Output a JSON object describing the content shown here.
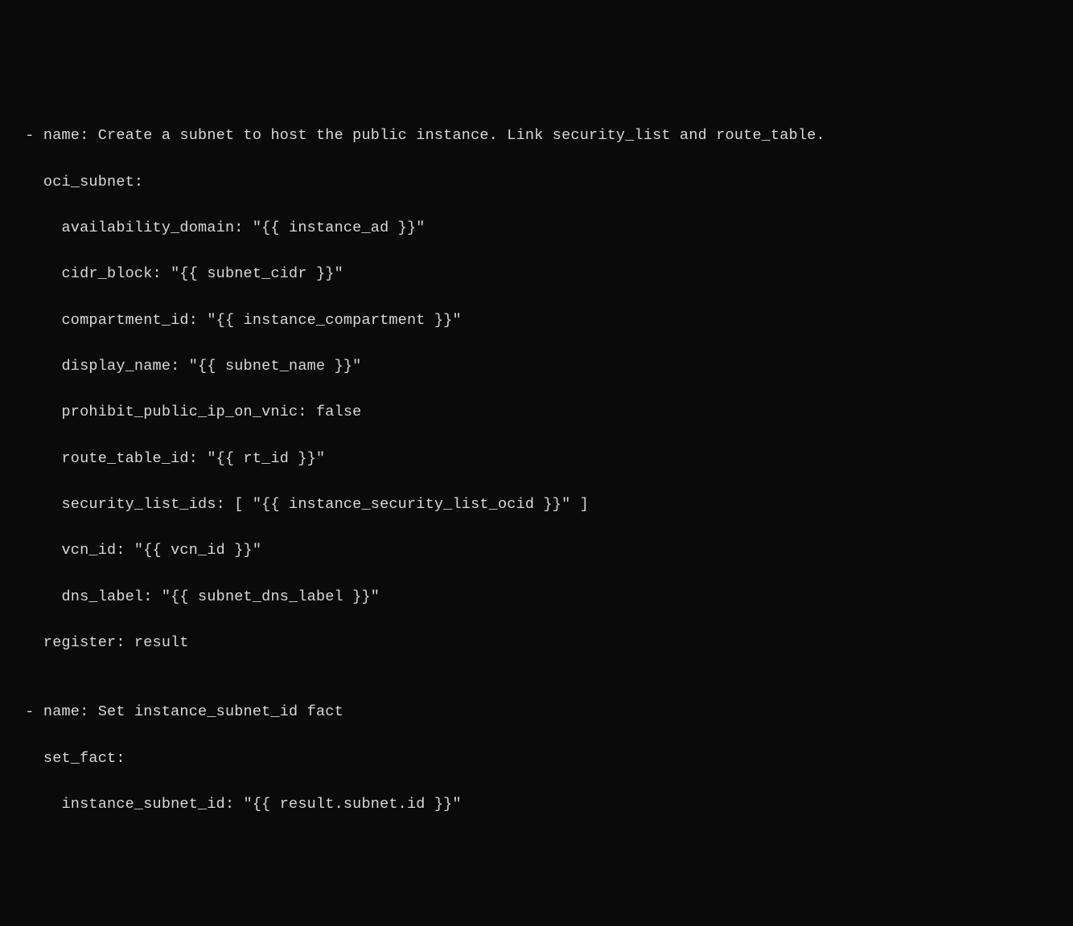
{
  "lines": [
    " - name: Create a subnet to host the public instance. Link security_list and route_table.",
    "   oci_subnet:",
    "     availability_domain: \"{{ instance_ad }}\"",
    "     cidr_block: \"{{ subnet_cidr }}\"",
    "     compartment_id: \"{{ instance_compartment }}\"",
    "     display_name: \"{{ subnet_name }}\"",
    "     prohibit_public_ip_on_vnic: false",
    "     route_table_id: \"{{ rt_id }}\"",
    "     security_list_ids: [ \"{{ instance_security_list_ocid }}\" ]",
    "     vcn_id: \"{{ vcn_id }}\"",
    "     dns_label: \"{{ subnet_dns_label }}\"",
    "   register: result",
    "",
    " - name: Set instance_subnet_id fact",
    "   set_fact:",
    "     instance_subnet_id: \"{{ result.subnet.id }}\""
  ]
}
